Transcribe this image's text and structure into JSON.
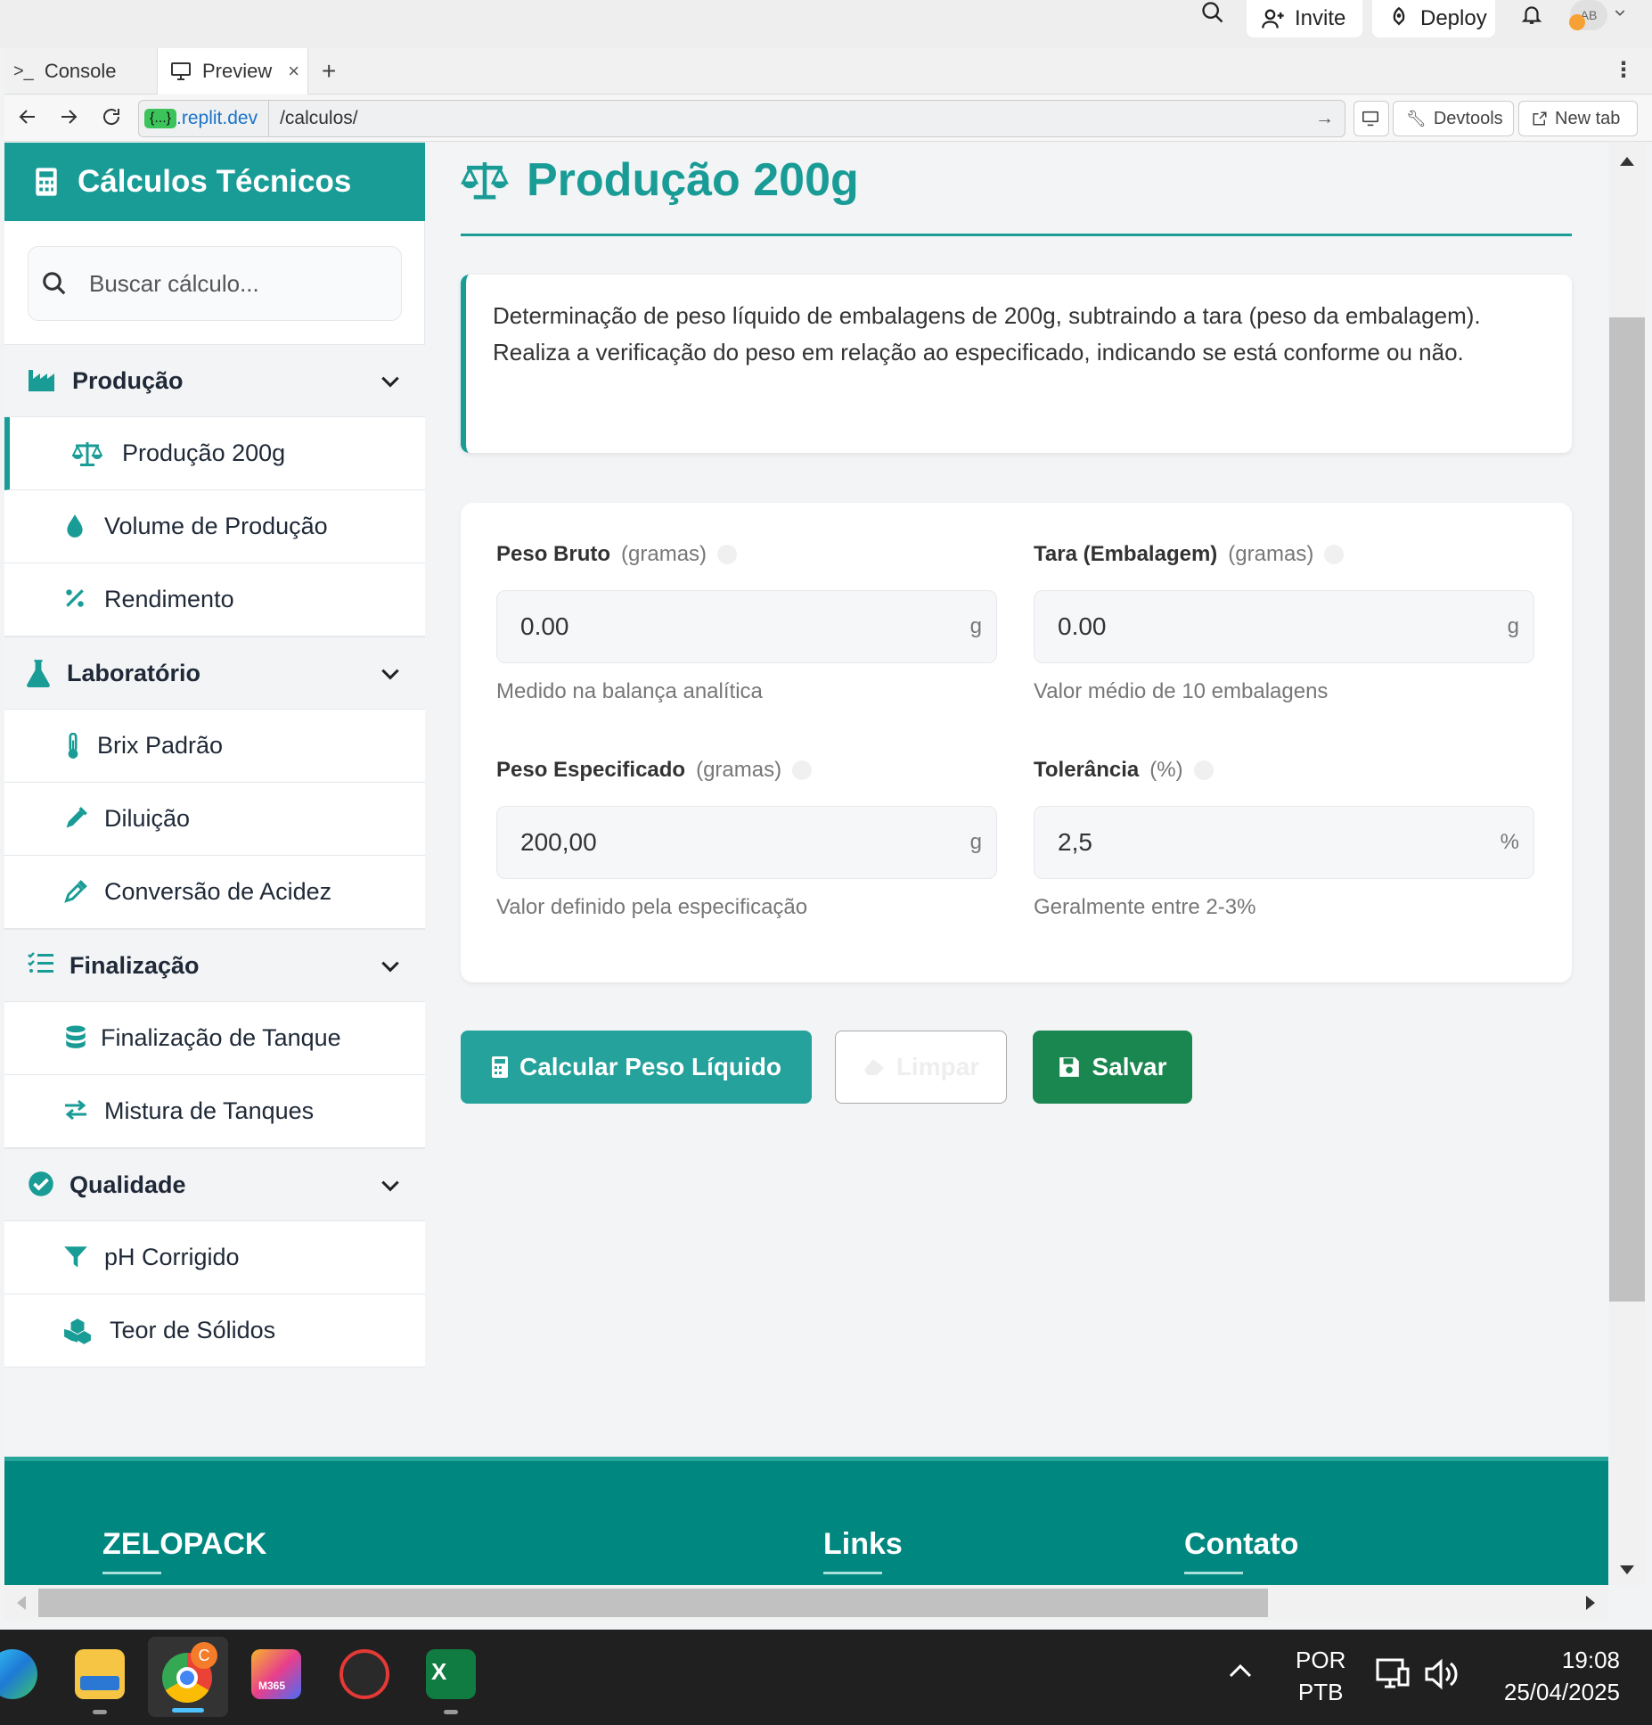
{
  "topbar": {
    "invite": "Invite",
    "deploy": "Deploy",
    "avatar": "AB"
  },
  "tabs": [
    {
      "label": "Console"
    },
    {
      "label": "Preview"
    }
  ],
  "urlbar": {
    "domain_badge": "{...}",
    "domain": ".replit.dev",
    "path": "/calculos/",
    "devtools": "Devtools",
    "new_tab": "New tab"
  },
  "sidebar": {
    "title": "Cálculos Técnicos",
    "search_placeholder": "Buscar cálculo...",
    "groups": [
      {
        "label": "Produção",
        "items": [
          "Produção 200g",
          "Volume de Produção",
          "Rendimento"
        ]
      },
      {
        "label": "Laboratório",
        "items": [
          "Brix Padrão",
          "Diluição",
          "Conversão de Acidez"
        ]
      },
      {
        "label": "Finalização",
        "items": [
          "Finalização de Tanque",
          "Mistura de Tanques"
        ]
      },
      {
        "label": "Qualidade",
        "items": [
          "pH Corrigido",
          "Teor de Sólidos"
        ]
      }
    ]
  },
  "main": {
    "title": "Produção 200g",
    "description": "Determinação de peso líquido de embalagens de 200g, subtraindo a tara (peso da embalagem). Realiza a verificação do peso em relação ao especificado, indicando se está conforme ou não.",
    "fields": [
      {
        "label": "Peso Bruto",
        "unit": "(gramas)",
        "value": "0.00",
        "suffix": "g",
        "help": "Medido na balança analítica"
      },
      {
        "label": "Tara (Embalagem)",
        "unit": "(gramas)",
        "value": "0.00",
        "suffix": "g",
        "help": "Valor médio de 10 embalagens"
      },
      {
        "label": "Peso Especificado",
        "unit": "(gramas)",
        "value": "200,00",
        "suffix": "g",
        "help": "Valor definido pela especificação"
      },
      {
        "label": "Tolerância",
        "unit": "(%)",
        "value": "2,5",
        "suffix": "%",
        "help": "Geralmente entre 2-3%"
      }
    ],
    "buttons": {
      "calculate": "Calcular Peso Líquido",
      "clear": "Limpar",
      "save": "Salvar"
    }
  },
  "footer": {
    "brand": "ZELOPACK",
    "links": "Links",
    "contact": "Contato"
  },
  "taskbar": {
    "lang1": "POR",
    "lang2": "PTB",
    "time": "19:08",
    "date": "25/04/2025",
    "chrome_badge": "C",
    "m365_label": "M365"
  },
  "colors": {
    "accent": "#1a9c96",
    "footer": "#00877f",
    "save": "#1b8750"
  }
}
